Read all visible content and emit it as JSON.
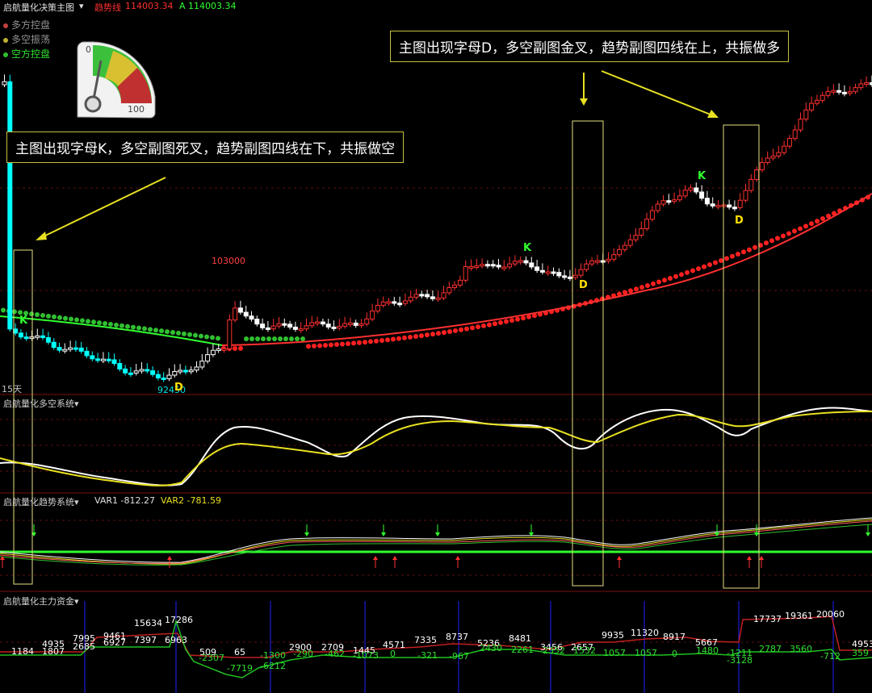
{
  "header": {
    "title": "启航量化决策主图",
    "trend_label": "趋势线",
    "trend_value": "114003.34",
    "a_label": "A",
    "a_value": "114003.34"
  },
  "legend": [
    {
      "label": "多方控盘",
      "color": "#c04040"
    },
    {
      "label": "多空振荡",
      "color": "#c0b030"
    },
    {
      "label": "空方控盘",
      "color": "#30c030"
    }
  ],
  "gauge": {
    "min": "0",
    "max": "100"
  },
  "callouts": {
    "top": "主图出现字母D，多空副图金叉，趋势副图四线在上，共振做多",
    "left": "主图出现字母K，多空副图死叉，趋势副图四线在下，共振做空"
  },
  "main_chart": {
    "high_label": "103000",
    "low_label": "92450",
    "period_label": "15天",
    "signals": [
      "K",
      "D",
      "K",
      "D",
      "K",
      "D"
    ]
  },
  "panels": {
    "duokong": {
      "title": "启航量化多空系统"
    },
    "trend": {
      "title": "启航量化趋势系统",
      "var1": "VAR1 -812.27",
      "var2": "VAR2 -781.59"
    },
    "capital": {
      "title": "启航量化主力资金"
    }
  },
  "capital_labels": {
    "upper": [
      "1184",
      "1807",
      "4935",
      "2685",
      "7995",
      "6927",
      "9461",
      "7397",
      "15634",
      "6963",
      "17286",
      "509",
      "65",
      "2900",
      "2709",
      "1445",
      "4571",
      "7335",
      "8737",
      "5236",
      "8481",
      "3456",
      "2657",
      "9935",
      "11320",
      "8917",
      "5667",
      "17737",
      "19361",
      "20060",
      "4953"
    ],
    "lower": [
      "-2307",
      "-7719",
      "-1300",
      "-6212",
      "-290",
      "-462",
      "-1073",
      "0",
      "-321",
      "-967",
      "2430",
      "2261",
      "2352",
      "1532",
      "1057",
      "1057",
      "0",
      "1480",
      "-1211",
      "-3128",
      "2787",
      "3560",
      "-712",
      "359"
    ]
  },
  "colors": {
    "up": "#ff3030",
    "down": "#00ffff",
    "ma_green": "#30ff30",
    "ma_red": "#ff2020",
    "callout_border": "#c8c040"
  }
}
